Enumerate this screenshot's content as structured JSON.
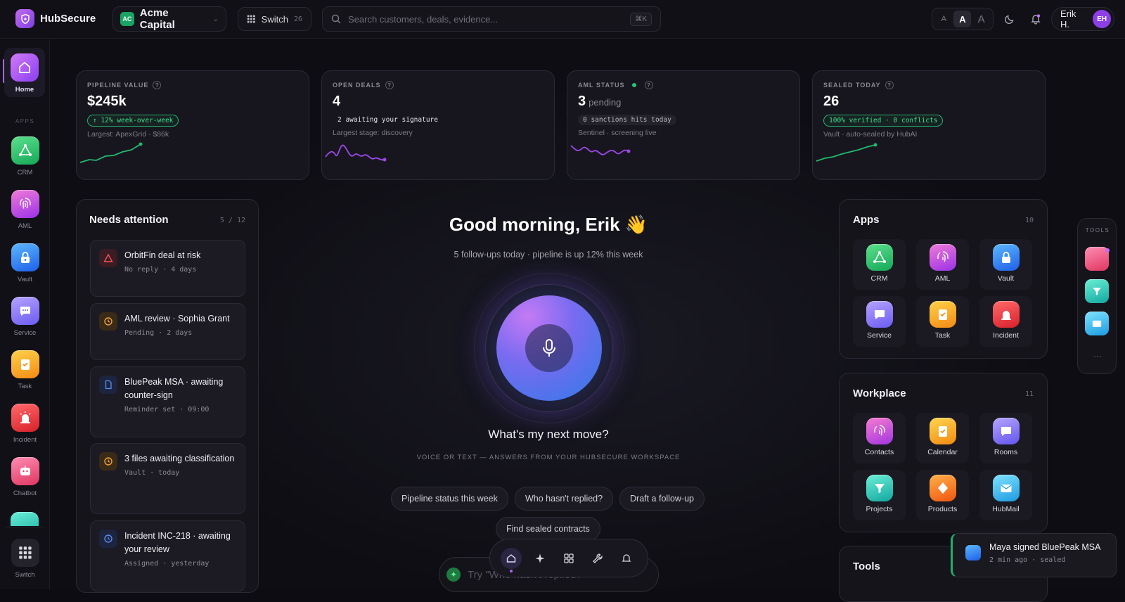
{
  "brand": {
    "name": "HubSecure"
  },
  "org": {
    "initials": "AC",
    "name": "Acme Capital"
  },
  "switch": {
    "label": "Switch",
    "count": "26"
  },
  "search": {
    "placeholder": "Search customers, deals, evidence...",
    "shortcut": "⌘K"
  },
  "font_size": {
    "small": "A",
    "medium": "A",
    "large": "A"
  },
  "user": {
    "name": "Erik H.",
    "initials": "EH"
  },
  "sidebar": {
    "home_label": "Home",
    "apps_heading": "APPS",
    "items": [
      {
        "label": "CRM",
        "icon": "crm-icon"
      },
      {
        "label": "AML",
        "icon": "fingerprint-icon"
      },
      {
        "label": "Vault",
        "icon": "lock-icon"
      },
      {
        "label": "Service",
        "icon": "chat-bubble-icon"
      },
      {
        "label": "Task",
        "icon": "checklist-icon"
      },
      {
        "label": "Incident",
        "icon": "siren-icon"
      },
      {
        "label": "Chatbot",
        "icon": "chatbot-icon"
      }
    ],
    "switch_label": "Switch"
  },
  "kpis": [
    {
      "label": "PIPELINE VALUE",
      "value": "$245k",
      "unit": "",
      "badge": "↑ 12% week-over-week",
      "sub": "Largest: ApexGrid · $86k"
    },
    {
      "label": "OPEN DEALS",
      "value": "4",
      "unit": "",
      "badge": "2 awaiting your signature",
      "sub": "Largest stage: discovery"
    },
    {
      "label": "AML STATUS",
      "value": "3",
      "unit": "pending",
      "badge": "0 sanctions hits today",
      "sub": "Sentinel · screening live"
    },
    {
      "label": "SEALED TODAY",
      "value": "26",
      "unit": "",
      "badge": "100% verified · 0 conflicts",
      "sub": "Vault · auto-sealed by HubAI"
    }
  ],
  "attention": {
    "title": "Needs attention",
    "count": "5 / 12",
    "items": [
      {
        "title": "OrbitFin deal at risk",
        "meta": "No reply · 4 days",
        "icon": "warning-icon"
      },
      {
        "title": "AML review · Sophia Grant",
        "meta": "Pending · 2 days",
        "icon": "clock-icon"
      },
      {
        "title": "BluePeak MSA · awaiting counter-sign",
        "meta": "Reminder set · 09:00",
        "icon": "document-icon"
      },
      {
        "title": "3 files awaiting classification",
        "meta": "Vault · today",
        "icon": "clock-icon"
      },
      {
        "title": "Incident INC-218 · awaiting your review",
        "meta": "Assigned · yesterday",
        "icon": "clock-icon"
      }
    ]
  },
  "center": {
    "greeting": "Good morning, Erik 👋",
    "summary": "5 follow-ups today · pipeline is up 12% this week",
    "question": "What's my next move?",
    "caption": "VOICE OR TEXT — ANSWERS FROM YOUR HUBSECURE WORKSPACE",
    "chips": [
      "Pipeline status this week",
      "Who hasn't replied?",
      "Draft a follow-up",
      "Find sealed contracts"
    ],
    "input_placeholder": "Try \"Who hasn't replied?\""
  },
  "apps_panel": {
    "title": "Apps",
    "count": "10",
    "tiles": [
      "CRM",
      "AML",
      "Vault",
      "Service",
      "Task",
      "Incident"
    ]
  },
  "workplace_panel": {
    "title": "Workplace",
    "count": "11",
    "tiles": [
      "Contacts",
      "Calendar",
      "Rooms",
      "Projects",
      "Products",
      "HubMail"
    ]
  },
  "tools_panel": {
    "title": "Tools"
  },
  "tools_rail": {
    "heading": "TOOLS",
    "more": "···"
  },
  "toast": {
    "title": "Maya signed BluePeak MSA",
    "meta": "2 min ago · sealed"
  },
  "colors": {
    "accent": "#b061f2",
    "positive": "#22b26a",
    "background": "#0d0c12"
  }
}
